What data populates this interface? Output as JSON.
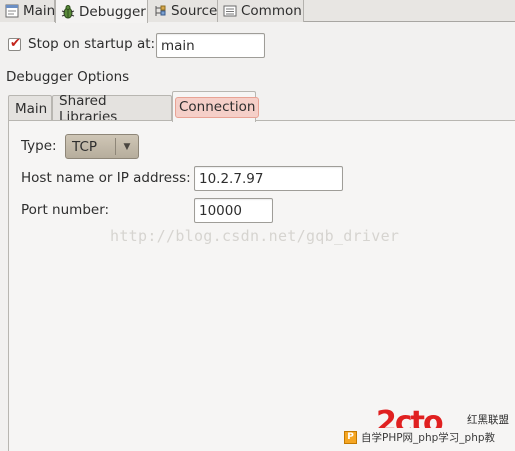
{
  "top_tabs": [
    {
      "label": "Main",
      "icon": "main-launch-icon",
      "active": false
    },
    {
      "label": "Debugger",
      "icon": "debugger-bug-icon",
      "active": true
    },
    {
      "label": "Source",
      "icon": "source-lookup-icon",
      "active": false
    },
    {
      "label": "Common",
      "icon": "common-settings-icon",
      "active": false
    }
  ],
  "startup": {
    "checked": true,
    "label": "Stop on startup at:",
    "value": "main"
  },
  "debugger_options": {
    "title": "Debugger Options",
    "tabs": [
      {
        "label": "Main",
        "active": false
      },
      {
        "label": "Shared Libraries",
        "active": false
      },
      {
        "label": "Connection",
        "active": true
      }
    ]
  },
  "connection": {
    "type_label": "Type:",
    "type_value": "TCP",
    "host_label": "Host name or IP address:",
    "host_value": "10.2.7.97",
    "port_label": "Port number:",
    "port_value": "10000"
  },
  "watermark": "http://blog.csdn.net/gqb_driver",
  "footer": {
    "brand": "红黑联盟",
    "text": "自学PHP网_php学习_php教"
  },
  "colors": {
    "checkbox_mark": "#c3241c",
    "active_tab_highlight": "#f5cfc8",
    "combo_bg": "#c4bba9",
    "logo_red": "#e02020"
  }
}
